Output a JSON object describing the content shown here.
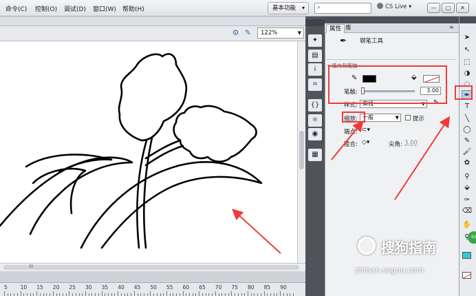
{
  "menu": {
    "items": [
      "命令(C)",
      "控制(O)",
      "调试(D)",
      "窗口(W)",
      "帮助(H)"
    ],
    "workspace": "基本功能",
    "search_placeholder": "",
    "cs_live": "CS Live"
  },
  "window_controls": {
    "minimize": "—",
    "restore": "□",
    "close": "✕"
  },
  "stage": {
    "zoom": "122%"
  },
  "ruler": {
    "labels": [
      "5",
      "10",
      "15",
      "20",
      "25",
      "30",
      "35",
      "40",
      "45",
      "50",
      "55",
      "60",
      "65",
      "70",
      "75",
      "80",
      "85",
      "90"
    ]
  },
  "scroll_marker": "III",
  "properties": {
    "tabs": [
      "属性",
      "库"
    ],
    "tool_name": "钢笔工具",
    "section_title": "填充和笔触",
    "stroke_label": "笔触:",
    "stroke_value": "3.00",
    "style_label": "样式:",
    "style_value": "实线",
    "scale_label": "缩放:",
    "scale_value": "一般",
    "hint_label": "提示",
    "cap_label": "端点:",
    "join_label": "接合:",
    "miter_label": "尖角:",
    "miter_value": "3.00"
  },
  "watermark": {
    "title": "搜狗指南",
    "url": "zhinan.sogou.com",
    "badge": "63"
  },
  "colors": {
    "accent_red": "#ef3b3b",
    "stroke": "#000000"
  },
  "icons": {
    "tools": [
      "selection-arrow-icon",
      "subselection-icon",
      "free-transform-icon",
      "3d-rotation-icon",
      "lasso-icon",
      "pen-tool-icon",
      "text-tool-icon",
      "line-tool-icon",
      "oval-tool-icon",
      "pencil-icon",
      "brush-icon",
      "deco-icon",
      "bone-icon",
      "paint-bucket-icon",
      "eyedropper-icon",
      "eraser-icon",
      "hand-icon",
      "zoom-icon",
      "stroke-color-icon",
      "fill-color-icon"
    ]
  }
}
